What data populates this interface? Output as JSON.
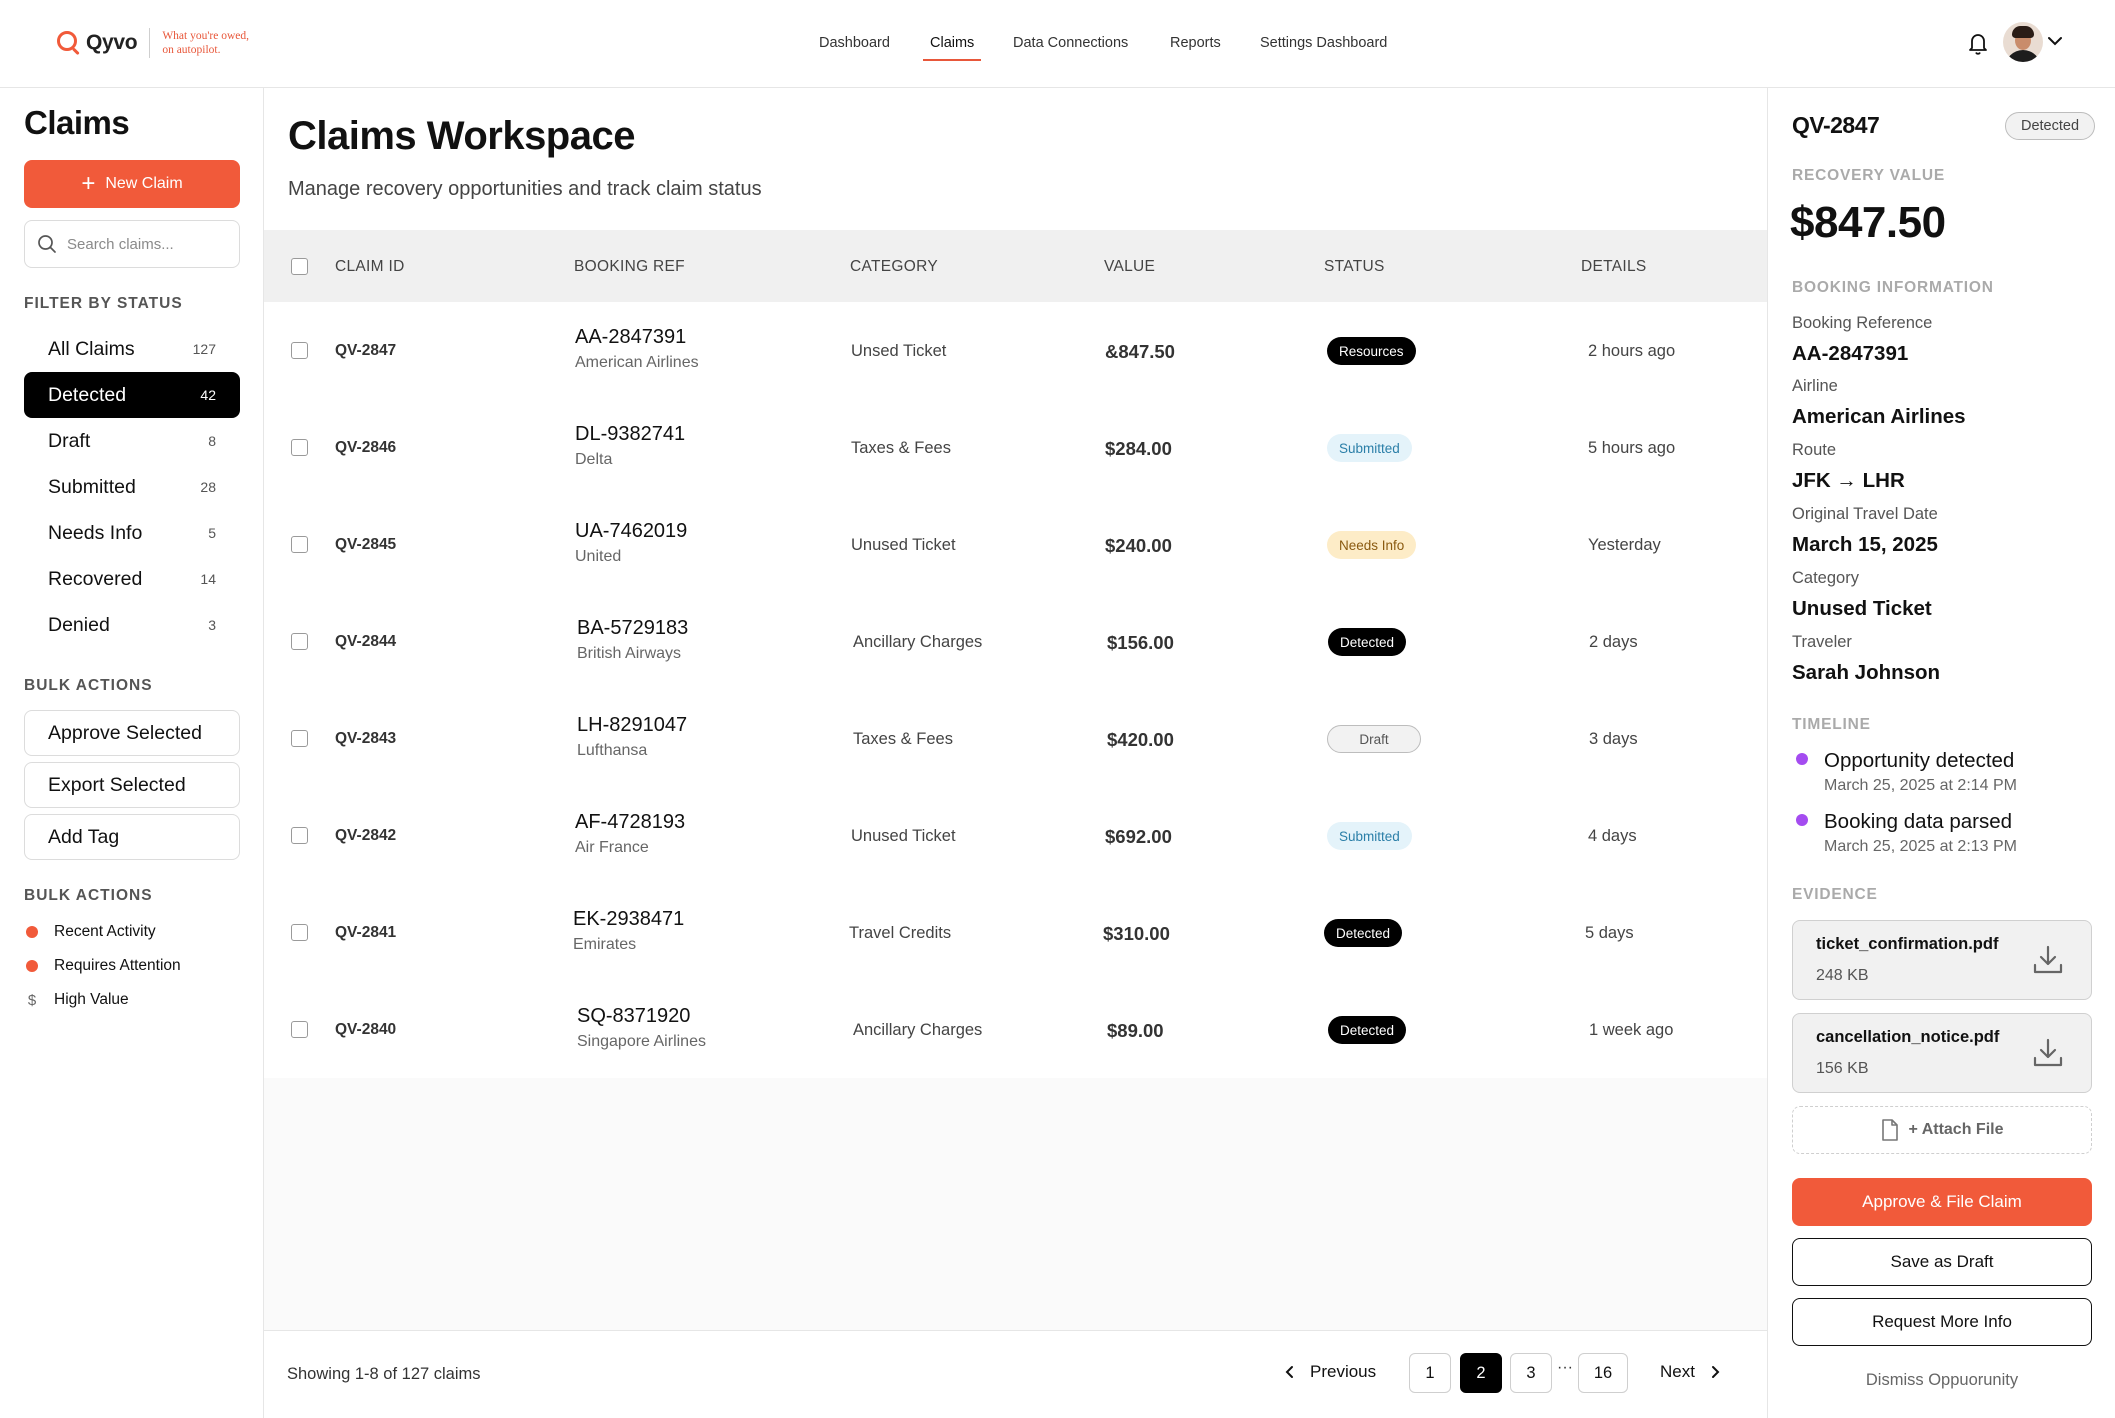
{
  "brand": {
    "name": "Qyvo",
    "tagline_line1": "What you're owed,",
    "tagline_line2": "on autopilot.",
    "accent_color": "#f15a3a"
  },
  "nav": {
    "items": [
      {
        "label": "Dashboard"
      },
      {
        "label": "Claims",
        "active": true
      },
      {
        "label": "Data Connections"
      },
      {
        "label": "Reports"
      },
      {
        "label": "Settings Dashboard"
      }
    ]
  },
  "header_icons": [
    "bell-icon",
    "user-avatar",
    "chevron-down-icon"
  ],
  "sidebar": {
    "title": "Claims",
    "new_claim_label": "New Claim",
    "search_placeholder": "Search claims...",
    "filter_label": "FILTER BY STATUS",
    "filters": [
      {
        "label": "All Claims",
        "count": "127"
      },
      {
        "label": "Detected",
        "count": "42",
        "active": true
      },
      {
        "label": "Draft",
        "count": "8"
      },
      {
        "label": "Submitted",
        "count": "28"
      },
      {
        "label": "Needs Info",
        "count": "5"
      },
      {
        "label": "Recovered",
        "count": "14"
      },
      {
        "label": "Denied",
        "count": "3"
      }
    ],
    "bulk_label": "BULK ACTIONS",
    "bulk_buttons": [
      {
        "label": "Approve Selected"
      },
      {
        "label": "Export Selected"
      },
      {
        "label": "Add Tag"
      }
    ],
    "bulk_label_2": "BULK ACTIONS",
    "bulk_links": [
      {
        "label": "Recent Activity",
        "icon": "dot"
      },
      {
        "label": "Requires Attention",
        "icon": "dot"
      },
      {
        "label": "High Value",
        "icon": "dollar",
        "glyph": "$"
      }
    ]
  },
  "main": {
    "title": "Claims Workspace",
    "subtitle": "Manage recovery opportunities and track claim status",
    "columns": {
      "claim_id": "CLAIM ID",
      "booking_ref": "BOOKING REF",
      "category": "CATEGORY",
      "value": "VALUE",
      "status": "STATUS",
      "details": "DETAILS"
    },
    "rows": [
      {
        "id": "QV-2847",
        "ref": "AA-2847391",
        "airline": "American Airlines",
        "category": "Unsed Ticket",
        "value": "&847.50",
        "status": "Resources",
        "status_style": "dark",
        "details": "2 hours ago"
      },
      {
        "id": "QV-2846",
        "ref": "DL-9382741",
        "airline": "Delta",
        "category": "Taxes & Fees",
        "value": "$284.00",
        "status": "Submitted",
        "status_style": "submitted",
        "details": "5 hours ago"
      },
      {
        "id": "QV-2845",
        "ref": "UA-7462019",
        "airline": "United",
        "category": "Unused Ticket",
        "value": "$240.00",
        "status": "Needs Info",
        "status_style": "needs",
        "details": "Yesterday"
      },
      {
        "id": "QV-2844",
        "ref": "BA-5729183",
        "airline": "British Airways",
        "category": "Ancillary Charges",
        "value": "$156.00",
        "status": "Detected",
        "status_style": "dark",
        "details": "2 days"
      },
      {
        "id": "QV-2843",
        "ref": "LH-8291047",
        "airline": "Lufthansa",
        "category": "Taxes & Fees",
        "value": "$420.00",
        "status": "Draft",
        "status_style": "draft",
        "details": "3 days"
      },
      {
        "id": "QV-2842",
        "ref": "AF-4728193",
        "airline": "Air France",
        "category": "Unused Ticket",
        "value": "$692.00",
        "status": "Submitted",
        "status_style": "submitted",
        "details": "4 days"
      },
      {
        "id": "QV-2841",
        "ref": "EK-2938471",
        "airline": "Emirates",
        "category": "Travel Credits",
        "value": "$310.00",
        "status": "Detected",
        "status_style": "dark",
        "details": "5 days"
      },
      {
        "id": "QV-2840",
        "ref": "SQ-8371920",
        "airline": "Singapore Airlines",
        "category": "Ancillary Charges",
        "value": "$89.00",
        "status": "Detected",
        "status_style": "dark",
        "details": "1 week ago"
      }
    ],
    "footer": {
      "showing": "Showing 1-8 of 127 claims",
      "prev_label": "Previous",
      "next_label": "Next",
      "pages": [
        "1",
        "2",
        "3",
        "16"
      ],
      "current_page": "2",
      "ellipsis": "···"
    }
  },
  "detail": {
    "id": "QV-2847",
    "status": "Detected",
    "recovery_label": "RECOVERY VALUE",
    "amount": "$847.50",
    "booking_label": "BOOKING INFORMATION",
    "fields": [
      {
        "key": "Booking Reference",
        "value": "AA-2847391"
      },
      {
        "key": "Airline",
        "value": "American Airlines"
      },
      {
        "key": "Route",
        "value": "JFK → LHR"
      },
      {
        "key": "Original Travel Date",
        "value": "March 15, 2025"
      },
      {
        "key": "Category",
        "value": "Unused Ticket"
      },
      {
        "key": "Traveler",
        "value": "Sarah Johnson"
      }
    ],
    "timeline_label": "TIMELINE",
    "timeline": [
      {
        "title": "Opportunity detected",
        "time": "March 25, 2025 at 2:14 PM"
      },
      {
        "title": "Booking data parsed",
        "time": "March 25, 2025 at 2:13 PM"
      }
    ],
    "timeline_color": "#a44cf0",
    "evidence_label": "EVIDENCE",
    "files": [
      {
        "name": "ticket_confirmation.pdf",
        "size": "248 KB"
      },
      {
        "name": "cancellation_notice.pdf",
        "size": "156 KB"
      }
    ],
    "attach_label": "+ Attach File",
    "approve_label": "Approve & File Claim",
    "draft_label": "Save as Draft",
    "request_label": "Request More Info",
    "dismiss_label": "Dismiss Oppuorunity"
  }
}
